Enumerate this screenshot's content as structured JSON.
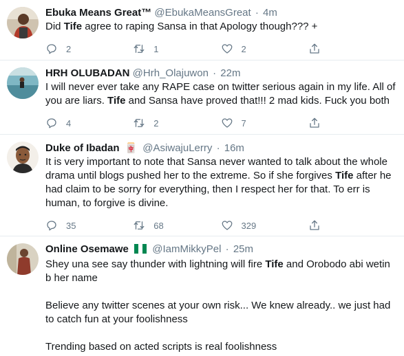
{
  "tweets": [
    {
      "display_name": "Ebuka Means Great™",
      "handle": "@EbukaMeansGreat",
      "time": "4m",
      "text_parts": [
        {
          "t": "Did ",
          "b": false
        },
        {
          "t": "Tife",
          "b": true
        },
        {
          "t": " agree to raping Sansa in that Apology though??? +",
          "b": false
        }
      ],
      "replies": "2",
      "retweets": "1",
      "likes": "2"
    },
    {
      "display_name": "HRH OLUBADAN",
      "handle": "@Hrh_Olajuwon",
      "time": "22m",
      "text_parts": [
        {
          "t": "I will never ever take any RAPE case on twitter serious again in my life. All of you are liars. ",
          "b": false
        },
        {
          "t": "Tife",
          "b": true
        },
        {
          "t": " and Sansa have proved that!!! 2 mad kids. Fuck you both",
          "b": false
        }
      ],
      "replies": "4",
      "retweets": "2",
      "likes": "7"
    },
    {
      "display_name": "Duke of Ibadan",
      "name_emoji": "🀄",
      "handle": "@AsiwajuLerry",
      "time": "16m",
      "text_parts": [
        {
          "t": "It is very important to note that Sansa never wanted to talk about the whole drama until blogs pushed her to the extreme. So if she forgives ",
          "b": false
        },
        {
          "t": "Tife",
          "b": true
        },
        {
          "t": " after he had claim to be sorry for everything, then I respect her for that. To err is human, to forgive is divine.",
          "b": false
        }
      ],
      "replies": "35",
      "retweets": "68",
      "likes": "329"
    },
    {
      "display_name": "Online Osemawe",
      "handle": "@IamMikkyPel",
      "time": "25m",
      "flag_colors": [
        "#008751",
        "#ffffff",
        "#008751"
      ],
      "para1_parts": [
        {
          "t": "Shey una see say thunder with lightning will fire ",
          "b": false
        },
        {
          "t": "Tife",
          "b": true
        },
        {
          "t": " and Orobodo abi wetin b her name",
          "b": false
        }
      ],
      "para2": "Believe any twitter scenes at your own risk... We knew already.. we just had to catch fun at your foolishness",
      "para3": "Trending based on acted scripts is real foolishness"
    }
  ]
}
